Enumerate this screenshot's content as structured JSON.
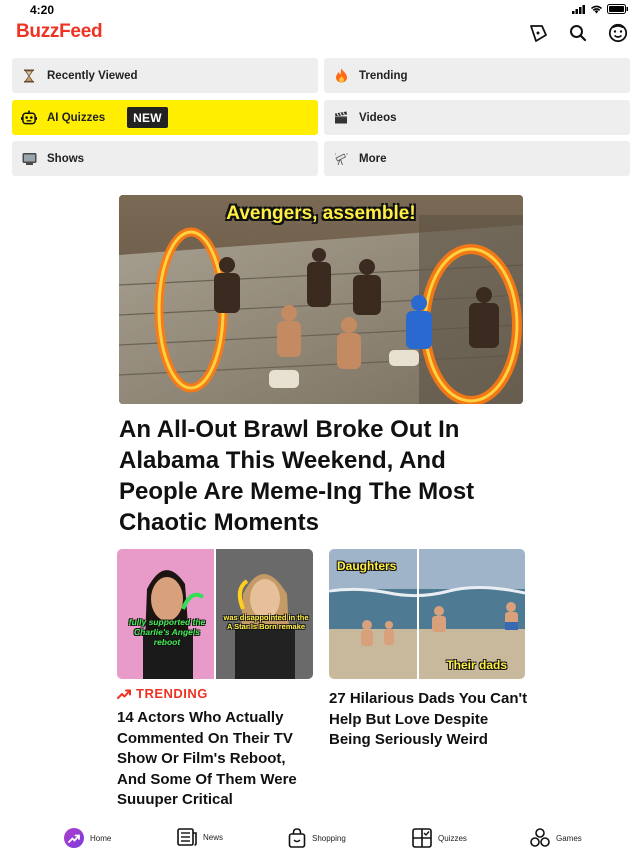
{
  "status": {
    "time": "4:20"
  },
  "header": {
    "logo": "BuzzFeed",
    "actions": [
      "badge-icon",
      "search-icon",
      "profile-icon"
    ]
  },
  "nav": {
    "tiles": [
      {
        "label": "Recently Viewed",
        "icon": "hourglass-icon"
      },
      {
        "label": "Trending",
        "icon": "fire-icon"
      },
      {
        "label": "AI Quizzes",
        "icon": "robot-icon",
        "badge": "NEW",
        "highlight": "#ffee00"
      },
      {
        "label": "Videos",
        "icon": "clapperboard-icon"
      },
      {
        "label": "Shows",
        "icon": "tv-icon"
      },
      {
        "label": "More",
        "icon": "telescope-icon"
      }
    ]
  },
  "hero": {
    "image_caption": "Avengers, assemble!",
    "title": "An All-Out Brawl Broke Out In Alabama This Weekend, And People Are Meme-Ing The Most Chaotic Moments"
  },
  "cards": [
    {
      "tag": "TRENDING",
      "image_text_left": "fully supported the Charlie's Angels reboot",
      "image_text_right": "was disappointed in the A Star Is Born remake",
      "title": "14 Actors Who Actually Commented On Their TV Show Or Film's Reboot, And Some Of Them Were Suuuper Critical"
    },
    {
      "image_text_top": "Daughters",
      "image_text_bottom": "Their dads",
      "title": "27 Hilarious Dads You Can't Help But Love Despite Being Seriously Weird"
    }
  ],
  "tabs": [
    {
      "label": "Home",
      "icon": "trending-arrow-icon",
      "active": true
    },
    {
      "label": "News",
      "icon": "newspaper-icon"
    },
    {
      "label": "Shopping",
      "icon": "shopping-bag-icon"
    },
    {
      "label": "Quizzes",
      "icon": "quiz-grid-icon"
    },
    {
      "label": "Games",
      "icon": "games-icon"
    }
  ],
  "colors": {
    "brand": "#ee3322",
    "ai_highlight": "#ffee00",
    "tile_bg": "#eeeeee"
  }
}
